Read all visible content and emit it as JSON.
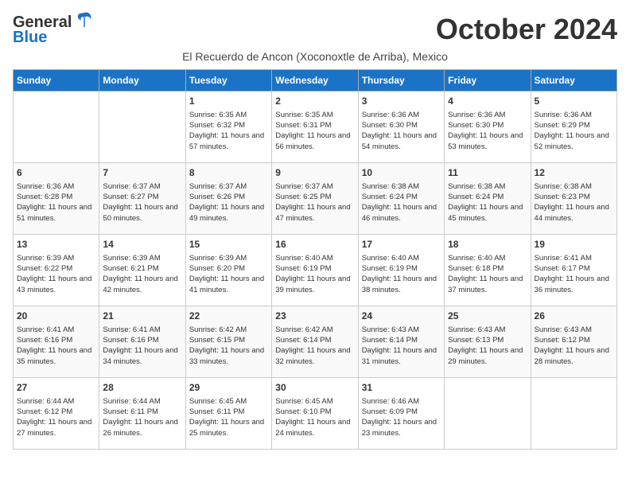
{
  "header": {
    "logo_general": "General",
    "logo_blue": "Blue",
    "month_title": "October 2024",
    "location": "El Recuerdo de Ancon (Xoconoxtle de Arriba), Mexico"
  },
  "weekdays": [
    "Sunday",
    "Monday",
    "Tuesday",
    "Wednesday",
    "Thursday",
    "Friday",
    "Saturday"
  ],
  "weeks": [
    [
      {
        "day": "",
        "info": ""
      },
      {
        "day": "",
        "info": ""
      },
      {
        "day": "1",
        "info": "Sunrise: 6:35 AM\nSunset: 6:32 PM\nDaylight: 11 hours and 57 minutes."
      },
      {
        "day": "2",
        "info": "Sunrise: 6:35 AM\nSunset: 6:31 PM\nDaylight: 11 hours and 56 minutes."
      },
      {
        "day": "3",
        "info": "Sunrise: 6:36 AM\nSunset: 6:30 PM\nDaylight: 11 hours and 54 minutes."
      },
      {
        "day": "4",
        "info": "Sunrise: 6:36 AM\nSunset: 6:30 PM\nDaylight: 11 hours and 53 minutes."
      },
      {
        "day": "5",
        "info": "Sunrise: 6:36 AM\nSunset: 6:29 PM\nDaylight: 11 hours and 52 minutes."
      }
    ],
    [
      {
        "day": "6",
        "info": "Sunrise: 6:36 AM\nSunset: 6:28 PM\nDaylight: 11 hours and 51 minutes."
      },
      {
        "day": "7",
        "info": "Sunrise: 6:37 AM\nSunset: 6:27 PM\nDaylight: 11 hours and 50 minutes."
      },
      {
        "day": "8",
        "info": "Sunrise: 6:37 AM\nSunset: 6:26 PM\nDaylight: 11 hours and 49 minutes."
      },
      {
        "day": "9",
        "info": "Sunrise: 6:37 AM\nSunset: 6:25 PM\nDaylight: 11 hours and 47 minutes."
      },
      {
        "day": "10",
        "info": "Sunrise: 6:38 AM\nSunset: 6:24 PM\nDaylight: 11 hours and 46 minutes."
      },
      {
        "day": "11",
        "info": "Sunrise: 6:38 AM\nSunset: 6:24 PM\nDaylight: 11 hours and 45 minutes."
      },
      {
        "day": "12",
        "info": "Sunrise: 6:38 AM\nSunset: 6:23 PM\nDaylight: 11 hours and 44 minutes."
      }
    ],
    [
      {
        "day": "13",
        "info": "Sunrise: 6:39 AM\nSunset: 6:22 PM\nDaylight: 11 hours and 43 minutes."
      },
      {
        "day": "14",
        "info": "Sunrise: 6:39 AM\nSunset: 6:21 PM\nDaylight: 11 hours and 42 minutes."
      },
      {
        "day": "15",
        "info": "Sunrise: 6:39 AM\nSunset: 6:20 PM\nDaylight: 11 hours and 41 minutes."
      },
      {
        "day": "16",
        "info": "Sunrise: 6:40 AM\nSunset: 6:19 PM\nDaylight: 11 hours and 39 minutes."
      },
      {
        "day": "17",
        "info": "Sunrise: 6:40 AM\nSunset: 6:19 PM\nDaylight: 11 hours and 38 minutes."
      },
      {
        "day": "18",
        "info": "Sunrise: 6:40 AM\nSunset: 6:18 PM\nDaylight: 11 hours and 37 minutes."
      },
      {
        "day": "19",
        "info": "Sunrise: 6:41 AM\nSunset: 6:17 PM\nDaylight: 11 hours and 36 minutes."
      }
    ],
    [
      {
        "day": "20",
        "info": "Sunrise: 6:41 AM\nSunset: 6:16 PM\nDaylight: 11 hours and 35 minutes."
      },
      {
        "day": "21",
        "info": "Sunrise: 6:41 AM\nSunset: 6:16 PM\nDaylight: 11 hours and 34 minutes."
      },
      {
        "day": "22",
        "info": "Sunrise: 6:42 AM\nSunset: 6:15 PM\nDaylight: 11 hours and 33 minutes."
      },
      {
        "day": "23",
        "info": "Sunrise: 6:42 AM\nSunset: 6:14 PM\nDaylight: 11 hours and 32 minutes."
      },
      {
        "day": "24",
        "info": "Sunrise: 6:43 AM\nSunset: 6:14 PM\nDaylight: 11 hours and 31 minutes."
      },
      {
        "day": "25",
        "info": "Sunrise: 6:43 AM\nSunset: 6:13 PM\nDaylight: 11 hours and 29 minutes."
      },
      {
        "day": "26",
        "info": "Sunrise: 6:43 AM\nSunset: 6:12 PM\nDaylight: 11 hours and 28 minutes."
      }
    ],
    [
      {
        "day": "27",
        "info": "Sunrise: 6:44 AM\nSunset: 6:12 PM\nDaylight: 11 hours and 27 minutes."
      },
      {
        "day": "28",
        "info": "Sunrise: 6:44 AM\nSunset: 6:11 PM\nDaylight: 11 hours and 26 minutes."
      },
      {
        "day": "29",
        "info": "Sunrise: 6:45 AM\nSunset: 6:11 PM\nDaylight: 11 hours and 25 minutes."
      },
      {
        "day": "30",
        "info": "Sunrise: 6:45 AM\nSunset: 6:10 PM\nDaylight: 11 hours and 24 minutes."
      },
      {
        "day": "31",
        "info": "Sunrise: 6:46 AM\nSunset: 6:09 PM\nDaylight: 11 hours and 23 minutes."
      },
      {
        "day": "",
        "info": ""
      },
      {
        "day": "",
        "info": ""
      }
    ]
  ]
}
